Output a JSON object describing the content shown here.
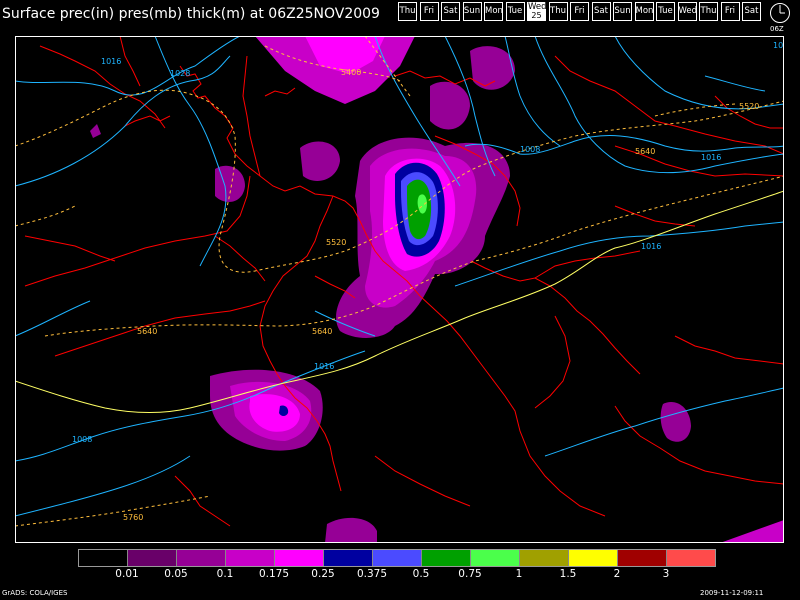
{
  "title": "Surface prec(in) pres(mb) thick(m) at 06Z25NOV2009",
  "day_strip": [
    {
      "label": "Thu"
    },
    {
      "label": "Fri"
    },
    {
      "label": "Sat"
    },
    {
      "label": "Sun"
    },
    {
      "label": "Mon"
    },
    {
      "label": "Tue"
    },
    {
      "label": "Wed",
      "num": "25",
      "selected": true
    },
    {
      "label": "Thu"
    },
    {
      "label": "Fri"
    },
    {
      "label": "Sat"
    },
    {
      "label": "Sun"
    },
    {
      "label": "Mon"
    },
    {
      "label": "Tue"
    },
    {
      "label": "Wed"
    },
    {
      "label": "Thu"
    },
    {
      "label": "Fri"
    },
    {
      "label": "Sat"
    }
  ],
  "clock_label": "06Z",
  "colorbar": {
    "colors": [
      "#000000",
      "#690069",
      "#960096",
      "#c800c8",
      "#ff00ff",
      "#0000a0",
      "#4b4bff",
      "#00a000",
      "#4bff4b",
      "#a0a000",
      "#ffff00",
      "#a00000",
      "#ff4b4b"
    ],
    "labels": [
      "0.01",
      "0.05",
      "0.1",
      "0.175",
      "0.25",
      "0.375",
      "0.5",
      "0.75",
      "1",
      "1.5",
      "2",
      "3"
    ]
  },
  "colors": {
    "pressure_contour": "#1eb4ff",
    "thickness_contour": "#ffbe3c",
    "border": "#ff0000",
    "thickness_5640": "#ffff64"
  },
  "contour_labels": {
    "pressure": [
      "1016",
      "1028",
      "1008",
      "1016",
      "1016",
      "1016",
      "1008"
    ],
    "thickness": [
      "5400",
      "5520",
      "5640",
      "5520",
      "5640",
      "5640",
      "5760"
    ]
  },
  "footer": {
    "left": "GrADS: COLA/IGES",
    "right": "2009-11-12-09:11"
  }
}
